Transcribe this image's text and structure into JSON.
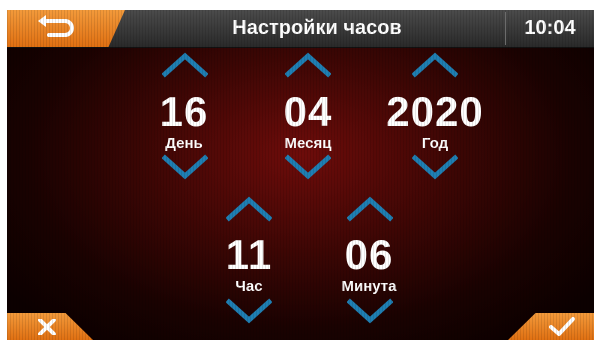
{
  "header": {
    "title": "Настройки часов",
    "clock": "10:04"
  },
  "fields": {
    "day": {
      "value": "16",
      "label": "День"
    },
    "month": {
      "value": "04",
      "label": "Месяц"
    },
    "year": {
      "value": "2020",
      "label": "Год"
    },
    "hour": {
      "value": "11",
      "label": "Час"
    },
    "minute": {
      "value": "06",
      "label": "Минута"
    }
  },
  "icons": {
    "back": "back-arrow-icon",
    "up": "chevron-up-icon",
    "down": "chevron-down-icon",
    "cancel": "close-icon",
    "confirm": "checkmark-icon"
  },
  "colors": {
    "accent": "#e8821e",
    "chevron": "#1f7fb3",
    "background": "#3a0604",
    "header": "#3a3a3a",
    "text": "#ffffff"
  }
}
